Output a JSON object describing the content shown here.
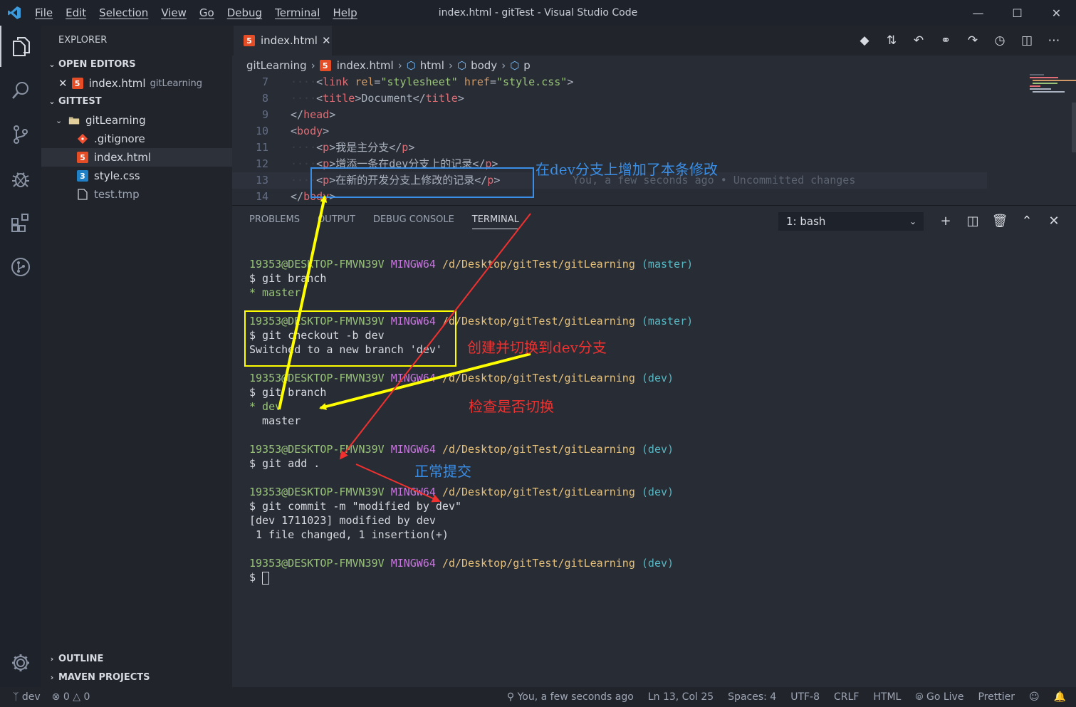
{
  "titlebar": {
    "menu": [
      "File",
      "Edit",
      "Selection",
      "View",
      "Go",
      "Debug",
      "Terminal",
      "Help"
    ],
    "title": "index.html - gitTest - Visual Studio Code",
    "controls": [
      "minimize-icon",
      "maximize-icon",
      "close-icon"
    ]
  },
  "activity_bar": [
    "explorer-icon",
    "search-icon",
    "source-control-icon",
    "debug-icon",
    "extensions-icon",
    "git-graph-icon",
    "settings-gear-icon"
  ],
  "sidebar": {
    "title": "EXPLORER",
    "open_editors_label": "OPEN EDITORS",
    "open_editor": {
      "name": "index.html",
      "folder": "gitLearning"
    },
    "workspace_label": "GITTEST",
    "folder": "gitLearning",
    "files": [
      {
        "name": ".gitignore",
        "icon": "git-icon"
      },
      {
        "name": "index.html",
        "icon": "html5-icon"
      },
      {
        "name": "style.css",
        "icon": "css3-icon"
      },
      {
        "name": "test.tmp",
        "icon": "file-icon"
      }
    ],
    "outline_label": "OUTLINE",
    "maven_label": "MAVEN PROJECTS"
  },
  "editor": {
    "tab_label": "index.html",
    "breadcrumb": [
      "gitLearning",
      "index.html",
      "html",
      "body",
      "p"
    ],
    "lines": [
      {
        "n": "7",
        "indent": "····",
        "open": "<",
        "tag": "link",
        "rest": " rel=\"stylesheet\" href=\"style.css\">"
      },
      {
        "n": "8",
        "indent": "····",
        "content": "<title>Document</title>"
      },
      {
        "n": "9",
        "indent": "",
        "content": "</head>"
      },
      {
        "n": "10",
        "indent": "",
        "content": "<body>"
      },
      {
        "n": "11",
        "indent": "····",
        "content": "<p>我是主分支</p>"
      },
      {
        "n": "12",
        "indent": "····",
        "content": "<p>增添一条在dev分支上的记录</p>"
      },
      {
        "n": "13",
        "indent": "····",
        "content": "<p>在新的开发分支上修改的记录</p>"
      },
      {
        "n": "14",
        "indent": "",
        "content": "</body>"
      }
    ],
    "blame": "You, a few seconds ago • Uncommitted changes"
  },
  "panel": {
    "tabs": [
      "PROBLEMS",
      "OUTPUT",
      "DEBUG CONSOLE",
      "TERMINAL"
    ],
    "active_tab": "TERMINAL",
    "terminal_select": "1: bash",
    "tools": [
      "add-terminal-icon",
      "split-terminal-icon",
      "trash-icon",
      "maximize-panel-icon",
      "close-panel-icon"
    ]
  },
  "terminal": {
    "user": "19353@DESKTOP-FMVN39V",
    "sys": "MINGW64",
    "path": "/d/Desktop/gitTest/gitLearning",
    "blocks": [
      {
        "branch": "(master)",
        "cmd": "$ git branch",
        "out": [
          {
            "star": "* master",
            "green": true
          }
        ]
      },
      {
        "branch": "(master)",
        "cmd": "$ git checkout -b dev",
        "out": [
          {
            "text": "Switched to a new branch 'dev'"
          }
        ]
      },
      {
        "branch": "(dev)",
        "cmd": "$ git branch",
        "out": [
          {
            "star": "* dev",
            "green": true
          },
          {
            "text": "  master"
          }
        ]
      },
      {
        "branch": "(dev)",
        "cmd": "$ git add .",
        "out": []
      },
      {
        "branch": "(dev)",
        "cmd": "$ git commit -m \"modified by dev\"",
        "out": [
          {
            "text": "[dev 1711023] modified by dev"
          },
          {
            "text": " 1 file changed, 1 insertion(+)"
          }
        ]
      },
      {
        "branch": "(dev)",
        "cmd": "$ ",
        "out": [],
        "cursor": true
      }
    ]
  },
  "annotations": {
    "edit_note": "在dev分支上增加了本条修改",
    "checkout_note": "创建并切换到dev分支",
    "check_note": "检查是否切换",
    "commit_note": "正常提交"
  },
  "statusbar": {
    "branch": "dev",
    "errors": "0",
    "warnings": "0",
    "blame": "You, a few seconds ago",
    "position": "Ln 13, Col 25",
    "spaces": "Spaces: 4",
    "encoding": "UTF-8",
    "eol": "CRLF",
    "language": "HTML",
    "golive": "Go Live",
    "prettier": "Prettier"
  },
  "colors": {
    "annotation_blue": "#3a8ee6",
    "annotation_red": "#f0312f",
    "annotation_yellow": "#ffff00"
  }
}
